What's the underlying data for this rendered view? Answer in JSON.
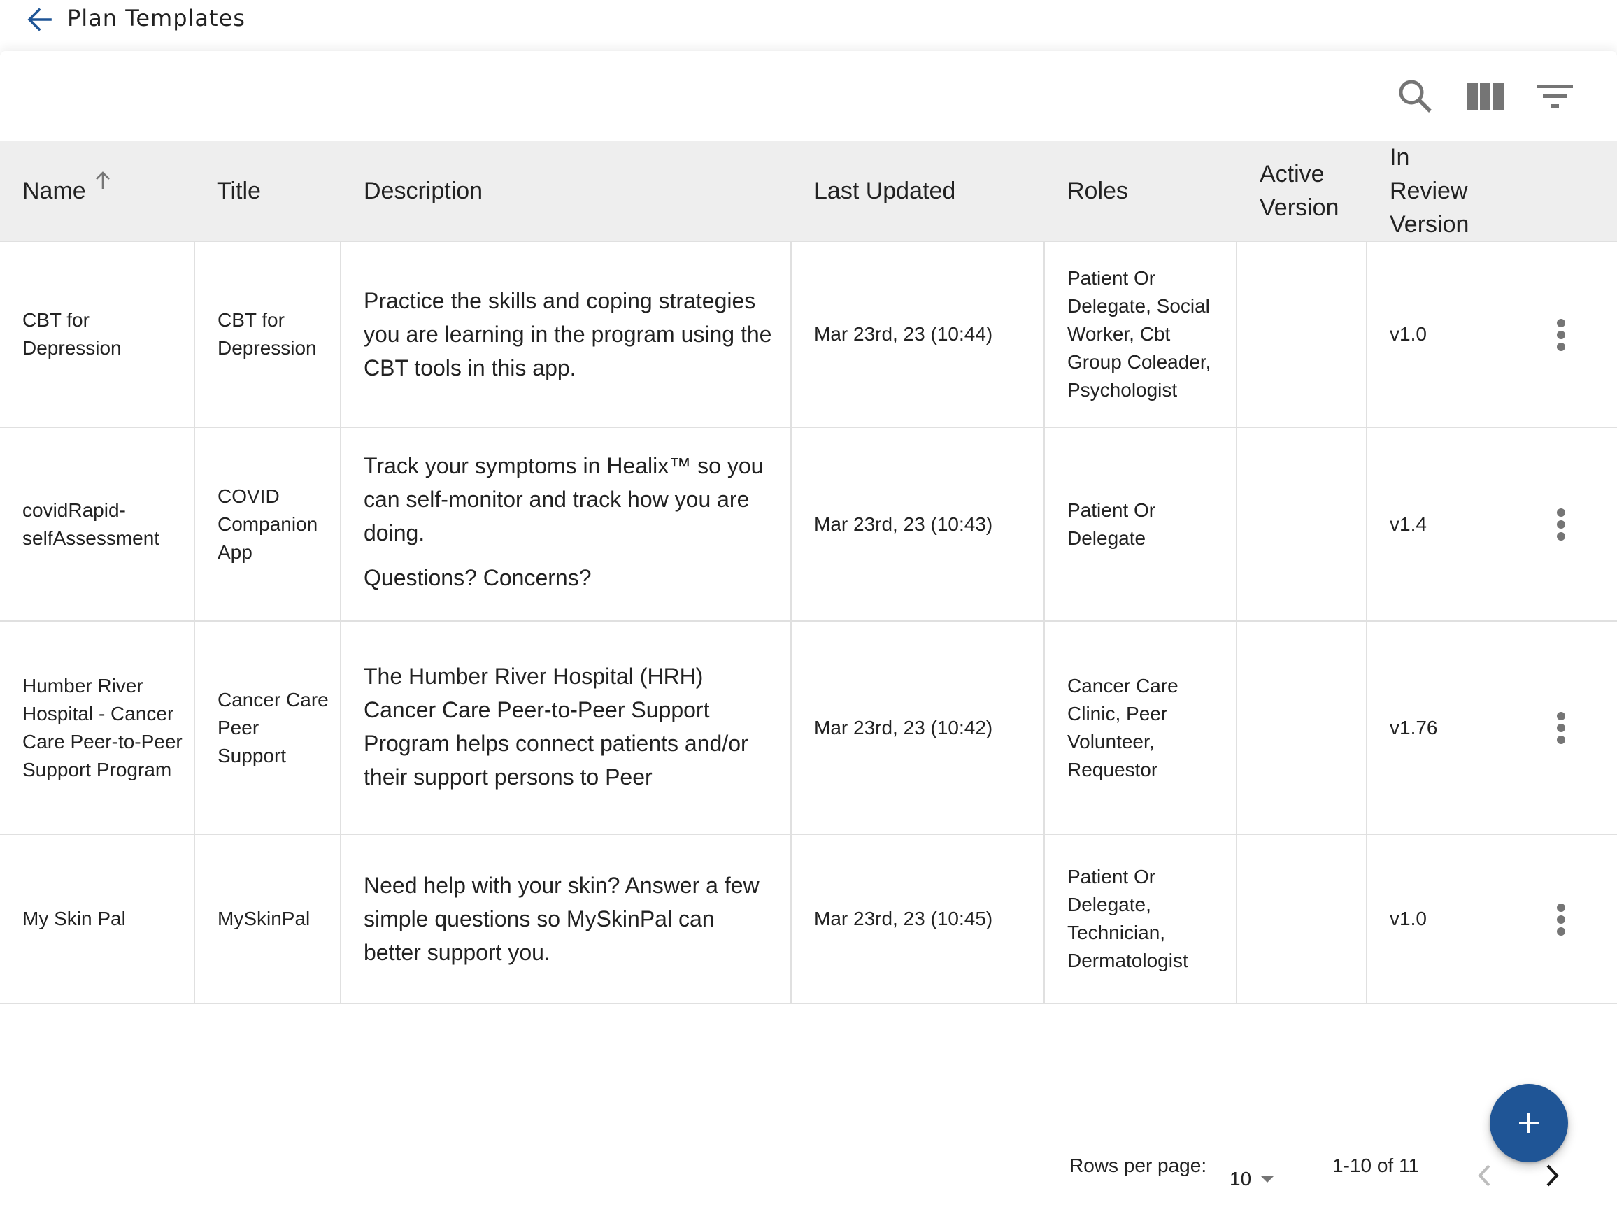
{
  "header": {
    "title": "Plan Templates",
    "back_icon": "arrow-left-icon"
  },
  "colors": {
    "accent": "#1f5596",
    "header_bg": "#eeeeee",
    "border": "#e0e0e0",
    "icon_gray": "#757575"
  },
  "toolbar": {
    "icons": [
      "search-icon",
      "view-columns-icon",
      "filter-list-icon"
    ]
  },
  "table": {
    "columns": [
      {
        "label": "Name",
        "sort": "ascending"
      },
      {
        "label": "Title"
      },
      {
        "label": "Description"
      },
      {
        "label": "Last Updated"
      },
      {
        "label": "Roles"
      },
      {
        "label": "Active Version"
      },
      {
        "label": "In Review Version"
      }
    ],
    "rows": [
      {
        "name": "CBT for Depression",
        "title": "CBT for Depression",
        "description": [
          "Practice the skills and coping strategies you are learning in the program using the CBT tools in this app."
        ],
        "last_updated": "Mar 23rd, 23 (10:44)",
        "roles": "Patient Or Delegate, Social Worker, Cbt Group Coleader, Psychologist",
        "active_version": "",
        "in_review_version": "v1.0"
      },
      {
        "name": "covidRapid-selfAssessment",
        "title": "COVID Companion App",
        "description": [
          "Track your symptoms in Healix™ so you can self-monitor and track how you are doing.",
          "Questions? Concerns?"
        ],
        "last_updated": "Mar 23rd, 23 (10:43)",
        "roles": "Patient Or Delegate",
        "active_version": "",
        "in_review_version": "v1.4"
      },
      {
        "name": "Humber River Hospital - Cancer Care Peer-to-Peer Support Program",
        "title": "Cancer Care Peer Support",
        "description": [
          "The Humber River Hospital (HRH) Cancer Care Peer-to-Peer Support Program helps connect patients and/or their support persons to Peer"
        ],
        "last_updated": "Mar 23rd, 23 (10:42)",
        "roles": "Cancer Care Clinic, Peer Volunteer, Requestor",
        "active_version": "",
        "in_review_version": "v1.76"
      },
      {
        "name": "My Skin Pal",
        "title": "MySkinPal",
        "description": [
          "Need help with your skin? Answer a few simple questions so MySkinPal can better support you."
        ],
        "last_updated": "Mar 23rd, 23 (10:45)",
        "roles": "Patient Or Delegate, Technician, Dermatologist",
        "active_version": "",
        "in_review_version": "v1.0"
      }
    ],
    "row_actions_icon": "more-vert-icon"
  },
  "pagination": {
    "rows_per_page_label": "Rows per page:",
    "rows_per_page_value": "10",
    "range_label": "1-10 of 11",
    "prev_enabled": false,
    "next_enabled": true
  },
  "fab": {
    "icon": "plus-icon",
    "action": "add"
  }
}
